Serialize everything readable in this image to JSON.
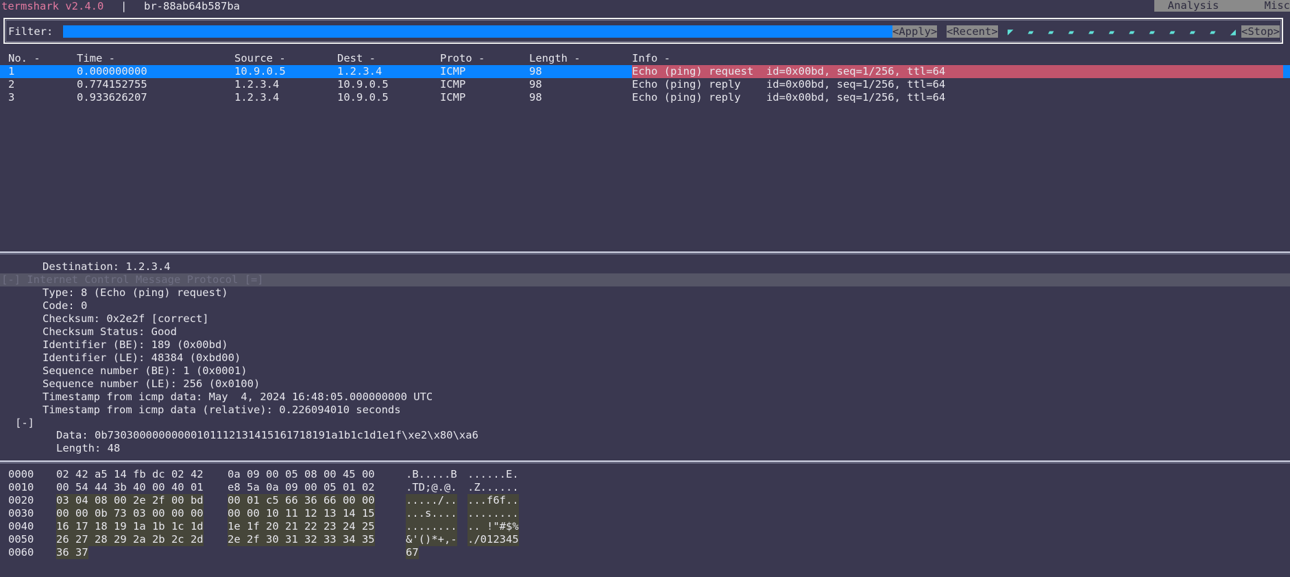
{
  "titlebar": {
    "app": "termshark v2.4.0",
    "separator": "|",
    "interface": "br-88ab64b587ba",
    "menus": [
      "Analysis",
      "Misc"
    ]
  },
  "filter": {
    "label": "Filter:",
    "value": "",
    "apply": "<Apply>",
    "recent": "<Recent>",
    "stop": "<Stop>",
    "spinner": [
      "◤",
      "▰",
      "▰",
      "▰",
      "▰",
      "▰",
      "▰",
      "▰",
      "▰",
      "▰",
      "▰",
      "◢"
    ]
  },
  "packet_list": {
    "columns": [
      "No. -",
      "Time -",
      "Source -",
      "Dest -",
      "Proto -",
      "Length -",
      "Info -"
    ],
    "rows": [
      {
        "no": "1",
        "time": "0.000000000",
        "source": "10.9.0.5",
        "dest": "1.2.3.4",
        "proto": "ICMP",
        "length": "98",
        "info": "Echo (ping) request  id=0x00bd, seq=1/256, ttl=64"
      },
      {
        "no": "2",
        "time": "0.774152755",
        "source": "1.2.3.4",
        "dest": "10.9.0.5",
        "proto": "ICMP",
        "length": "98",
        "info": "Echo (ping) reply    id=0x00bd, seq=1/256, ttl=64"
      },
      {
        "no": "3",
        "time": "0.933626207",
        "source": "1.2.3.4",
        "dest": "10.9.0.5",
        "proto": "ICMP",
        "length": "98",
        "info": "Echo (ping) reply    id=0x00bd, seq=1/256, ttl=64"
      }
    ]
  },
  "details": {
    "destination": "Destination: 1.2.3.4",
    "icmp_header": "[-] Internet Control Message Protocol [=]",
    "fields": [
      "Type: 8 (Echo (ping) request)",
      "Code: 0",
      "Checksum: 0x2e2f [correct]",
      "Checksum Status: Good",
      "Identifier (BE): 189 (0x00bd)",
      "Identifier (LE): 48384 (0xbd00)",
      "Sequence number (BE): 1 (0x0001)",
      "Sequence number (LE): 256 (0x0100)",
      "Timestamp from icmp data: May  4, 2024 16:48:05.000000000 UTC",
      "Timestamp from icmp data (relative): 0.226094010 seconds"
    ],
    "data_toggle": "[-]",
    "data_fields": [
      "Data: 0b73030000000000101112131415161718191a1b1c1d1e1f\\xe2\\x80\\xa6",
      "Length: 48"
    ]
  },
  "hex": {
    "lines": [
      {
        "offset": "0000",
        "hex1": "02 42 a5 14 fb dc 02 42",
        "hex2": "0a 09 00 05 08 00 45 00",
        "ascii1": ".B.....B",
        "ascii2": "......E.",
        "hl1": false,
        "hl2": false
      },
      {
        "offset": "0010",
        "hex1": "00 54 44 3b 40 00 40 01",
        "hex2": "e8 5a 0a 09 00 05 01 02",
        "ascii1": ".TD;@.@.",
        "ascii2": ".Z......",
        "hl1": false,
        "hl2": false
      },
      {
        "offset": "0020",
        "hex1": "03 04 08 00 2e 2f 00 bd",
        "hex2": "00 01 c5 66 36 66 00 00",
        "ascii1": "...../..",
        "ascii2": "...f6f..",
        "hl1": true,
        "hl2": true
      },
      {
        "offset": "0030",
        "hex1": "00 00 0b 73 03 00 00 00",
        "hex2": "00 00 10 11 12 13 14 15",
        "ascii1": "...s....",
        "ascii2": "........",
        "hl1": true,
        "hl2": true
      },
      {
        "offset": "0040",
        "hex1": "16 17 18 19 1a 1b 1c 1d",
        "hex2": "1e 1f 20 21 22 23 24 25",
        "ascii1": "........",
        "ascii2": ".. !\"#$%",
        "hl1": true,
        "hl2": true
      },
      {
        "offset": "0050",
        "hex1": "26 27 28 29 2a 2b 2c 2d",
        "hex2": "2e 2f 30 31 32 33 34 35",
        "ascii1": "&'()*+,-",
        "ascii2": "./012345",
        "hl1": true,
        "hl2": true
      },
      {
        "offset": "0060",
        "hex1": "36 37",
        "hex2": "",
        "ascii1": "67",
        "ascii2": "",
        "hl1": true,
        "hl2": false
      }
    ]
  }
}
